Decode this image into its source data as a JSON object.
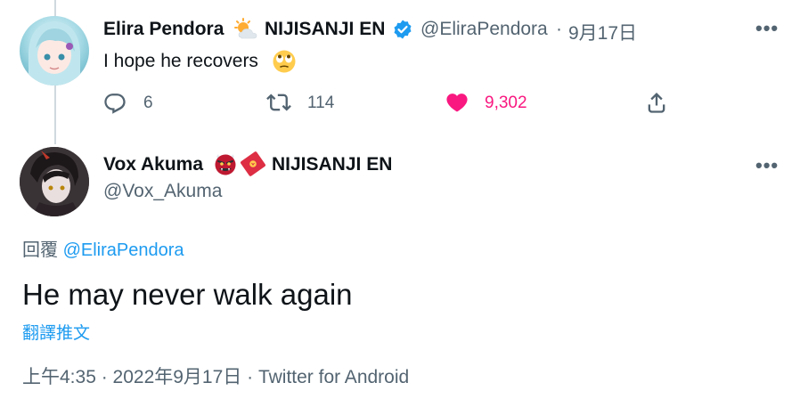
{
  "parent_tweet": {
    "display_name": "Elira Pendora",
    "name_suffix": "NIJISANJI EN",
    "handle": "@EliraPendora",
    "separator": "·",
    "date": "9月17日",
    "text": "I hope he recovers",
    "reply_count": "6",
    "retweet_count": "114",
    "like_count": "9,302",
    "liked": true,
    "verified": true
  },
  "main_tweet": {
    "display_name": "Vox Akuma",
    "name_suffix": "NIJISANJI EN",
    "handle": "@Vox_Akuma",
    "reply_prefix": "回覆",
    "reply_to_handle": "@EliraPendora",
    "text": "He may never walk again",
    "translate_label": "翻譯推文",
    "timestamp": "上午4:35 · 2022年9月17日 · ",
    "source": "Twitter for Android"
  },
  "colors": {
    "accent": "#1d9bf0",
    "like": "#f91880",
    "secondary_text": "#536471",
    "thread_line": "#cfd9de"
  },
  "icons": {
    "reply": "reply-icon",
    "retweet": "retweet-icon",
    "like": "heart-icon",
    "share": "share-icon",
    "more": "more-icon",
    "verified": "verified-badge-icon",
    "emoji_weather": "sun-behind-cloud-emoji",
    "emoji_eyes": "rolling-eyes-emoji",
    "emoji_ogre": "ogre-emoji",
    "emoji_envelope": "red-envelope-emoji"
  }
}
